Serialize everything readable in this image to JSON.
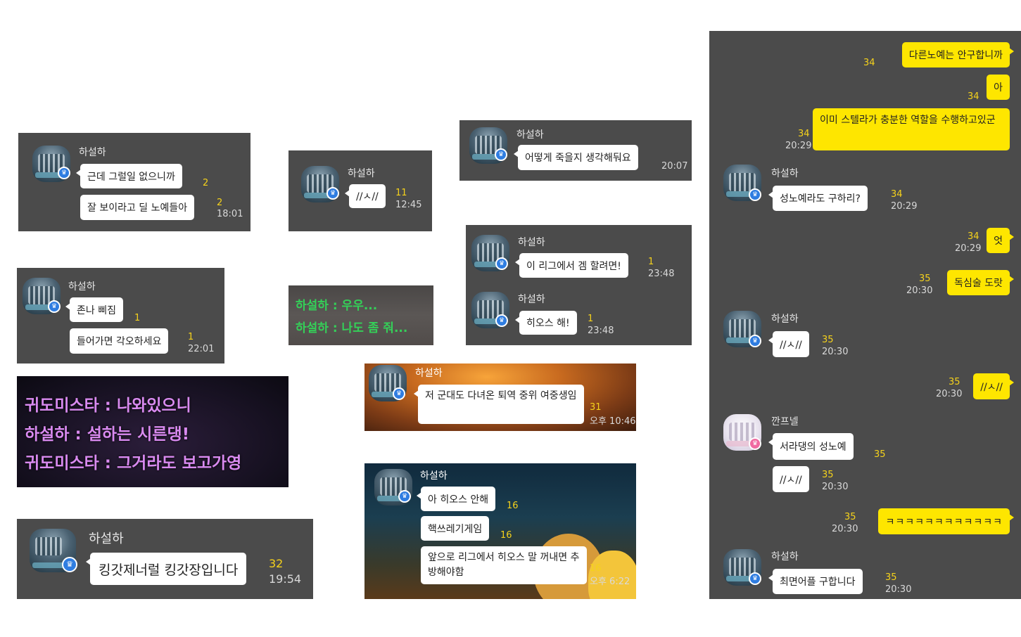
{
  "panel1": {
    "name": "하설하",
    "msg1": "근데 그럴일 없으니까",
    "cnt1": "2",
    "msg2": "잘 보이라고 딜 노예들아",
    "cnt2": "2",
    "time": "18:01"
  },
  "panel2": {
    "name": "하설하",
    "msg1": "//ㅅ//",
    "cnt1": "11",
    "time": "12:45"
  },
  "panel3": {
    "name": "하설하",
    "msg1": "어떻게 죽을지 생각해둬요",
    "time": "20:07"
  },
  "panel4": {
    "name": "하설하",
    "msg1": "존나 삐짐",
    "cnt1": "1",
    "msg2": "들어가면 각오하세요",
    "cnt2": "1",
    "time": "22:01"
  },
  "game1": {
    "line1": "하설하 : 우우...",
    "line2": "하설하 : 나도 좀 줘..."
  },
  "panel5": {
    "name1": "하설하",
    "msg1": "이 리그에서 겜 할려면!",
    "cnt1": "1",
    "time1": "23:48",
    "name2": "하설하",
    "msg2": "히오스 해!",
    "cnt2": "1",
    "time2": "23:48"
  },
  "game2": {
    "line1": "귀도미스타 : 나와있으니",
    "line2": "하설하 : 설하는 시른댕!",
    "line3": "귀도미스타 : 그거라도 보고가영"
  },
  "panel6": {
    "name": "하설하",
    "msg1": "저 군대도 다녀온 퇴역 중위 여중생임",
    "cnt1": "31",
    "time": "오후 10:46"
  },
  "panel7": {
    "name": "하설하",
    "msg1": "킹갓제너럴 킹갓장입니다",
    "cnt1": "32",
    "time": "19:54"
  },
  "panel8": {
    "name": "하설하",
    "msg1": "아 히오스 안해",
    "cnt1": "16",
    "msg2": "핵쓰레기게임",
    "cnt2": "16",
    "msg3": "앞으로 리그에서 히오스 말 꺼내면 추방해야함",
    "cnt3": "16",
    "time": "오후 6:22"
  },
  "right": {
    "my1": {
      "text": "다른노예는 안구합니까",
      "cnt": "34"
    },
    "my2": {
      "text": "아",
      "cnt": "34"
    },
    "my3": {
      "text": "이미 스텔라가 충분한 역할을 수행하고있군",
      "cnt": "34",
      "time": "20:29"
    },
    "their1": {
      "name": "하설하",
      "text": "성노예라도 구하리?",
      "cnt": "34",
      "time": "20:29"
    },
    "my4": {
      "text": "엇",
      "cnt": "34",
      "time": "20:29"
    },
    "my5": {
      "text": "독심술 도랏",
      "cnt": "35",
      "time": "20:30"
    },
    "their2": {
      "name": "하설하",
      "text": "//ㅅ//",
      "cnt": "35",
      "time": "20:30"
    },
    "my6": {
      "text": "//ㅅ//",
      "cnt": "35",
      "time": "20:30"
    },
    "their3": {
      "name": "깐프넬",
      "text1": "서라댕의 성노예",
      "cnt1": "35",
      "text2": "//ㅅ//",
      "cnt2": "35",
      "time2": "20:30"
    },
    "my7": {
      "text": "ㅋㅋㅋㅋㅋㅋㅋㅋㅋㅋㅋㅋ",
      "cnt": "35",
      "time": "20:30"
    },
    "their4": {
      "name": "하설하",
      "text": "최면어플 구합니다",
      "cnt": "35",
      "time": "20:30"
    }
  }
}
